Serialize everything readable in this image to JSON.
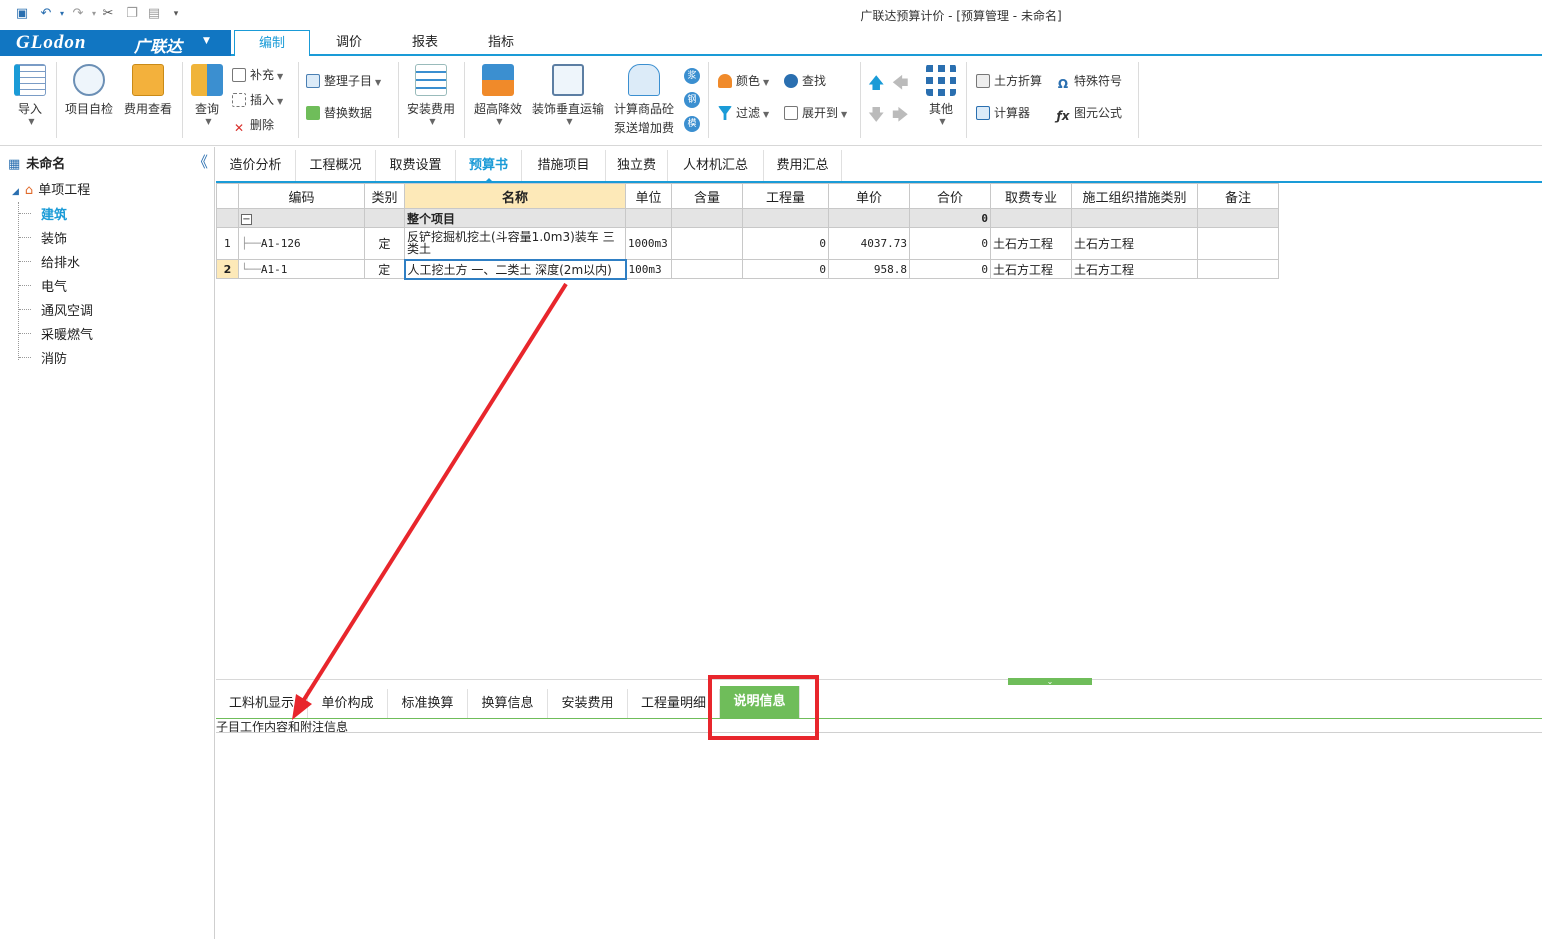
{
  "window": {
    "title": "广联达预算计价 - [预算管理 - 未命名]"
  },
  "menubar": {
    "logo_text": "GLodon",
    "logo_cn": "广联达",
    "tabs": [
      {
        "label": "编制"
      },
      {
        "label": "调价"
      },
      {
        "label": "报表"
      },
      {
        "label": "指标"
      }
    ]
  },
  "ribbon": {
    "import": "导入",
    "self_check": "项目自检",
    "fee_view": "费用查看",
    "query": "查询",
    "supplement": "补充",
    "insert": "插入",
    "delete": "删除",
    "organize": "整理子目",
    "replace": "替换数据",
    "install_fee": "安装费用",
    "height_reduce": "超高降效",
    "vertical_transport": "装饰垂直运输",
    "concrete_line1": "计算商品砼",
    "concrete_line2": "泵送增加费",
    "circle_1": "浆",
    "circle_2": "钢",
    "circle_3": "模",
    "color": "颜色",
    "find": "查找",
    "filter": "过滤",
    "expand_to": "展开到",
    "other": "其他",
    "earthwork": "土方折算",
    "special_symbol": "特殊符号",
    "calculator": "计算器",
    "formula": "图元公式"
  },
  "tree": {
    "root": "未命名",
    "project": "单项工程",
    "items": [
      "建筑",
      "装饰",
      "给排水",
      "电气",
      "通风空调",
      "采暖燃气",
      "消防"
    ]
  },
  "content_tabs": [
    "造价分析",
    "工程概况",
    "取费设置",
    "预算书",
    "措施项目",
    "独立费",
    "人材机汇总",
    "费用汇总"
  ],
  "grid": {
    "headers": [
      "",
      "编码",
      "类别",
      "名称",
      "单位",
      "含量",
      "工程量",
      "单价",
      "合价",
      "取费专业",
      "施工组织措施类别",
      "备注"
    ],
    "group": {
      "toggle": "−",
      "name": "整个项目",
      "total": "0"
    },
    "rows": [
      {
        "no": "1",
        "code": "A1-126",
        "type": "定",
        "name": "反铲挖掘机挖土(斗容量1.0m3)装车 三类土",
        "unit": "1000m3",
        "content": "",
        "quantity": "0",
        "price": "4037.73",
        "total": "0",
        "fee": "土石方工程",
        "measure": "土石方工程",
        "note": ""
      },
      {
        "no": "2",
        "code": "A1-1",
        "type": "定",
        "name": "人工挖土方 一、二类土 深度(2m以内)",
        "unit": "100m3",
        "content": "",
        "quantity": "0",
        "price": "958.8",
        "total": "0",
        "fee": "土石方工程",
        "measure": "土石方工程",
        "note": ""
      }
    ]
  },
  "bottom_tabs": [
    "工料机显示",
    "单价构成",
    "标准换算",
    "换算信息",
    "安装费用",
    "工程量明细",
    "说明信息"
  ],
  "bottom_content": {
    "label": "子目工作内容和附注信息"
  },
  "colors": {
    "accent": "#1a9bd7",
    "logo": "#1176c2",
    "active_green": "#6fbd5a",
    "annotation": "#e8262c"
  }
}
